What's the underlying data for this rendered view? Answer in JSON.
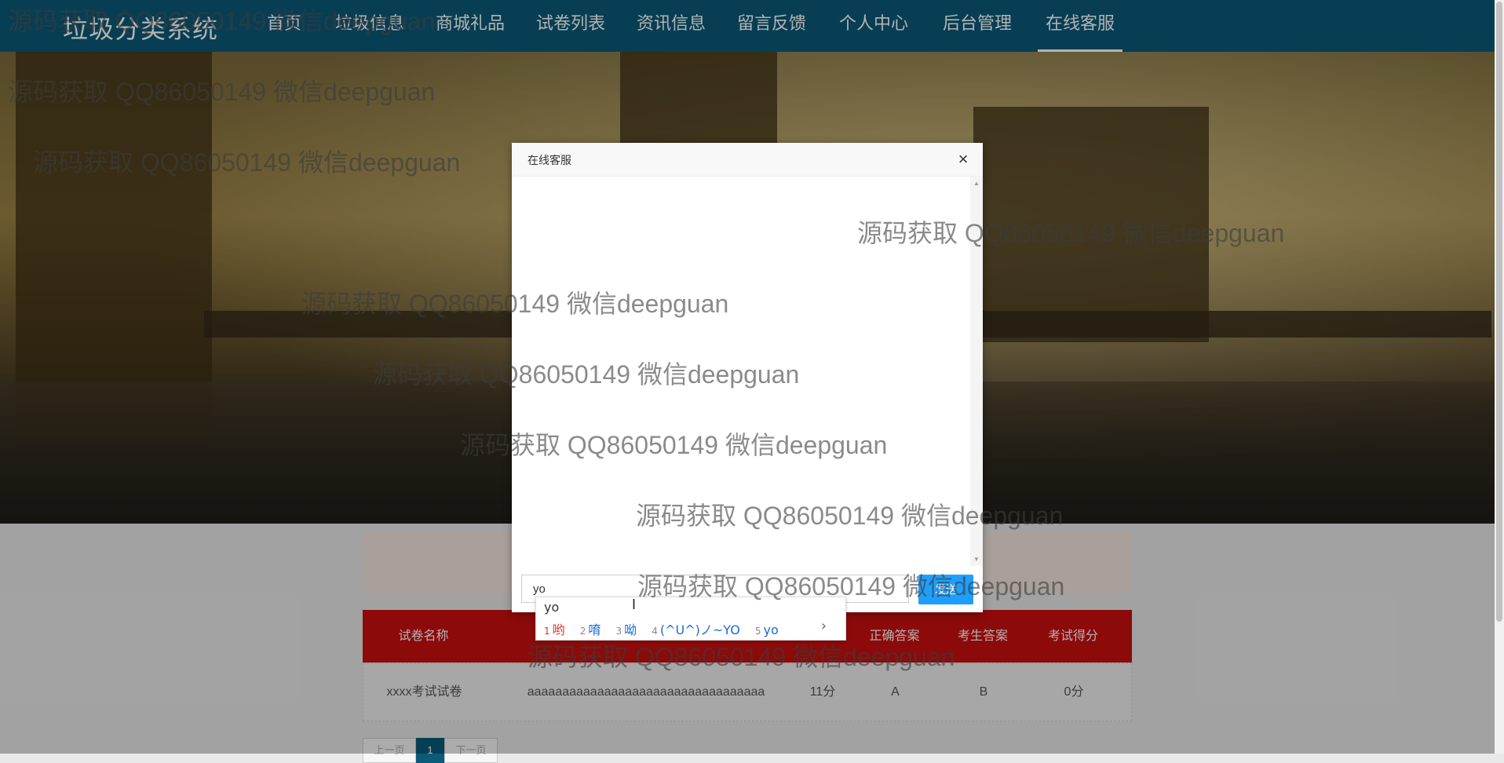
{
  "navbar": {
    "brand": "垃圾分类系统",
    "items": [
      "首页",
      "垃圾信息",
      "商城礼品",
      "试卷列表",
      "资讯信息",
      "留言反馈",
      "个人中心",
      "后台管理",
      "在线客服"
    ]
  },
  "table": {
    "headers": [
      "试卷名称",
      "正确答案",
      "考生答案",
      "考试得分"
    ],
    "row": {
      "name": "xxxx考试试卷",
      "question": "aaaaaaaaaaaaaaaaaaaaaaaaaaaaaaaaaa",
      "score_value": "11分",
      "correct": "A",
      "answer": "B",
      "result": "0分"
    }
  },
  "pagination": {
    "prev": "上一页",
    "current": "1",
    "next": "下一页"
  },
  "dialog": {
    "title": "在线客服",
    "close": "×",
    "input_value": "yo",
    "send_label": "发送"
  },
  "ime": {
    "pinyin": "yo",
    "candidates": [
      {
        "num": "1",
        "text": "哟"
      },
      {
        "num": "2",
        "text": "唷"
      },
      {
        "num": "3",
        "text": "呦"
      },
      {
        "num": "4",
        "text": "(^U^)ノ~YO"
      },
      {
        "num": "5",
        "text": "yo"
      }
    ],
    "next": "›"
  },
  "watermark": "源码获取 QQ86050149 微信deepguan",
  "colors": {
    "navbar": "#0b5a78",
    "table_header": "#c90f0f",
    "send_button": "#1e9fff"
  }
}
